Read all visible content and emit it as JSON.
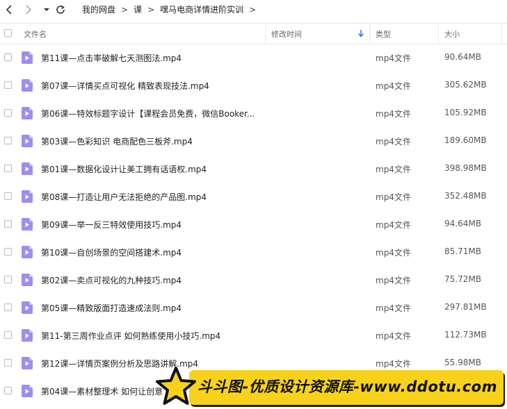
{
  "nav": {
    "breadcrumbs": [
      "我的网盘",
      "课",
      "嘿马电商详情进阶实训"
    ],
    "separator": ">"
  },
  "header": {
    "name": "文件名",
    "modified": "修改时间",
    "type": "类型",
    "size": "大小"
  },
  "files": [
    {
      "name": "第11课—点击率破解七天测图法.mp4",
      "type": "mp4文件",
      "size": "90.64MB"
    },
    {
      "name": "第07课—详情买点可视化 精致表现技法.mp4",
      "type": "mp4文件",
      "size": "305.62MB"
    },
    {
      "name": "第06课—特效标题字设计【课程会员免费，微信Booker...",
      "type": "mp4文件",
      "size": "105.92MB"
    },
    {
      "name": "第03课—色彩知识 电商配色三板斧.mp4",
      "type": "mp4文件",
      "size": "189.60MB"
    },
    {
      "name": "第01课—数据化设计让美工拥有话语权.mp4",
      "type": "mp4文件",
      "size": "398.98MB"
    },
    {
      "name": "第08课—打造让用户无法拒绝的产品图.mp4",
      "type": "mp4文件",
      "size": "352.48MB"
    },
    {
      "name": "第09课—举一反三特效使用技巧.mp4",
      "type": "mp4文件",
      "size": "94.64MB"
    },
    {
      "name": "第10课—自创场景的空间搭建术.mp4",
      "type": "mp4文件",
      "size": "85.71MB"
    },
    {
      "name": "第02课—卖点可视化的九种技巧.mp4",
      "type": "mp4文件",
      "size": "75.72MB"
    },
    {
      "name": "第05课—精致版面打造速成法则.mp4",
      "type": "mp4文件",
      "size": "297.81MB"
    },
    {
      "name": "第11-第三周作业点评 如何熟练使用小技巧.mp4",
      "type": "mp4文件",
      "size": "112.73MB"
    },
    {
      "name": "第12课—详情页案例分析及思路讲解.mp4",
      "type": "mp4文件",
      "size": "55.98MB"
    },
    {
      "name": "第04课—素材整理术 如何让创意",
      "type": "",
      "size": ""
    }
  ],
  "watermark": {
    "text": "斗斗图-优质设计资源库-www.ddotu.com"
  },
  "colors": {
    "file_icon": "#9b8ef0",
    "accent": "#2b7ee6",
    "watermark_bg": "#f8d21a"
  },
  "icons": [
    "back-icon",
    "forward-icon",
    "dropdown-icon",
    "refresh-icon",
    "sort-desc-icon",
    "video-file-icon",
    "star-icon"
  ]
}
